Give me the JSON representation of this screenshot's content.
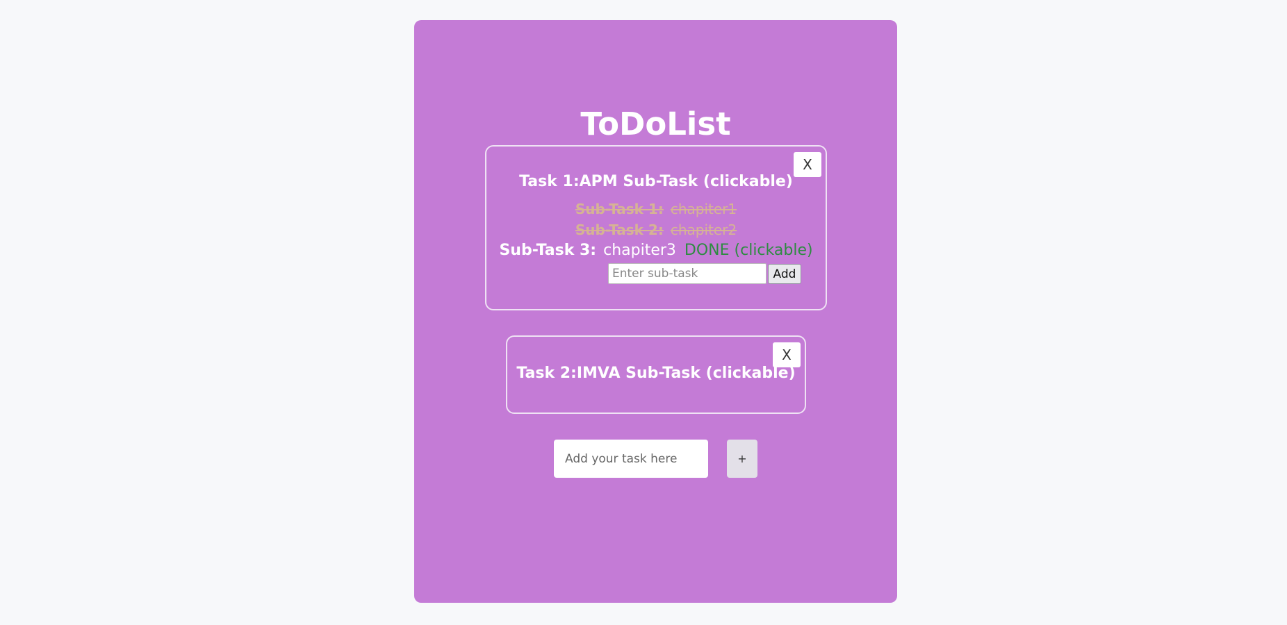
{
  "app": {
    "title": "ToDoList"
  },
  "tasks": [
    {
      "title": "Task 1:APM Sub-Task (clickable)",
      "close_label": "X",
      "subtasks": [
        {
          "label": "Sub-Task 1:",
          "text": "chapiter1",
          "status": "completed"
        },
        {
          "label": "Sub-Task 2:",
          "text": "chapiter2",
          "status": "completed"
        },
        {
          "label": "Sub-Task 3:",
          "text": "chapiter3",
          "status": "open",
          "done_label": "DONE (clickable)"
        }
      ],
      "subtask_input": {
        "placeholder": "Enter sub-task",
        "value": ""
      },
      "subtask_add_label": "Add"
    },
    {
      "title": "Task 2:IMVA Sub-Task (clickable)",
      "close_label": "X"
    }
  ],
  "new_task": {
    "placeholder": "Add your task here",
    "value": "",
    "add_label": "+"
  },
  "colors": {
    "page_background": "#f7f8fa",
    "panel_background": "#c47bd6",
    "completed_subtask": "#d6b394",
    "done_link": "#2e8b42"
  }
}
